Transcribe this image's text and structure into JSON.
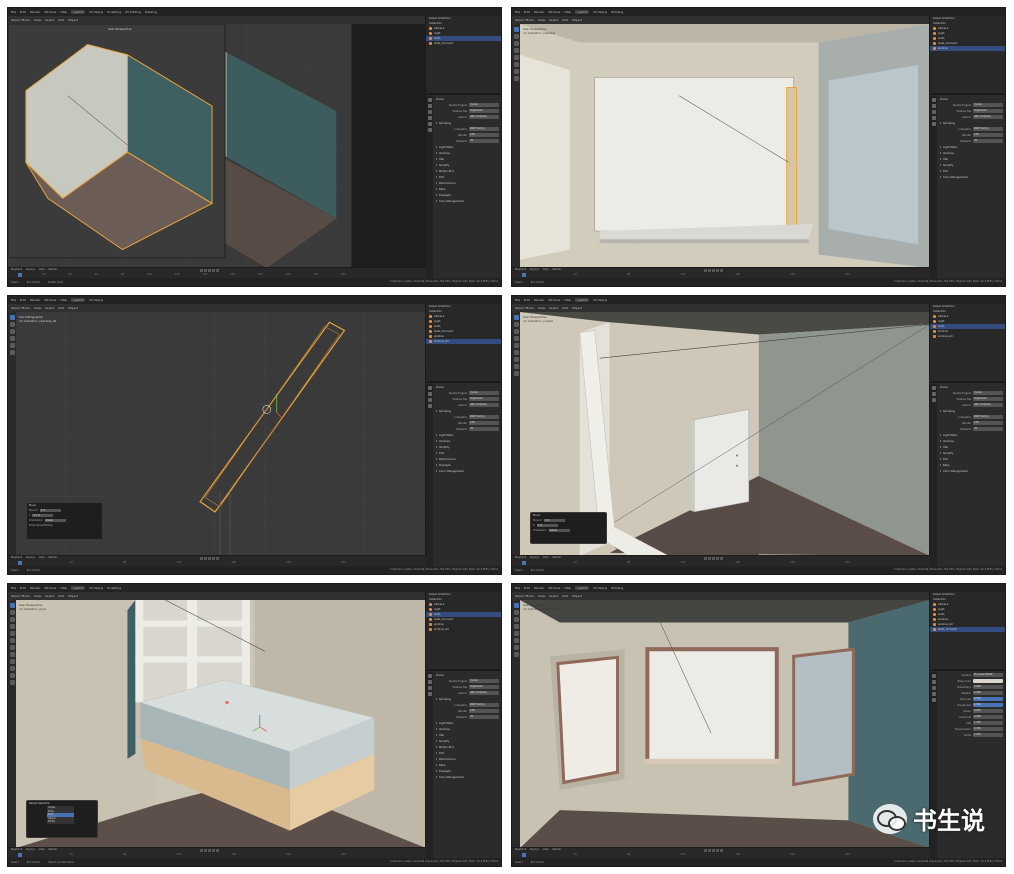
{
  "app": {
    "menus": [
      "File",
      "Edit",
      "Render",
      "Window",
      "Help"
    ],
    "workspaces": [
      "Layout",
      "Modeling",
      "Sculpting",
      "UV Editing",
      "Texture Paint",
      "Shading",
      "Animation",
      "Rendering",
      "Compositing",
      "Scripting"
    ],
    "scene_label": "Scene",
    "view_layer_label": "View Layer"
  },
  "viewport_header": {
    "mode": "Object Mode",
    "menus": [
      "View",
      "Select",
      "Add",
      "Object"
    ],
    "orientation": "Global"
  },
  "outliner": {
    "root": "Scene Collection",
    "collection": "Collection",
    "items": [
      "Camera",
      "Light",
      "walls",
      "walls_mirrored",
      "window",
      "window_sill"
    ]
  },
  "properties": {
    "render_title": "Scene",
    "render_engine_label": "Render Engine",
    "render_engine": "Cycles",
    "feature_set_label": "Feature Set",
    "feature_set": "Supported",
    "device_label": "Device",
    "device": "GPU Compute",
    "sections": [
      "Sampling",
      "Light Paths",
      "Volumes",
      "Hair",
      "Simplify",
      "Motion Blur",
      "Film",
      "Performance",
      "Bake",
      "Freestyle",
      "Color Management"
    ],
    "integrator_label": "Integrator",
    "integrator": "Path Tracing",
    "render_label": "Render",
    "render_value": "128",
    "viewport_label": "Viewport",
    "viewport_value": "32"
  },
  "material_props": {
    "surface_label": "Surface",
    "surface_value": "Principled BSDF",
    "base_color_label": "Base Color",
    "subsurface_label": "Subsurface",
    "subsurface_value": "0.000",
    "metallic_label": "Metallic",
    "metallic_value": "0.000",
    "specular_label": "Specular",
    "specular_value": "0.500",
    "roughness_label": "Roughness",
    "roughness_value": "0.500",
    "sheen_label": "Sheen",
    "sheen_value": "0.000",
    "clearcoat_label": "Clearcoat",
    "clearcoat_value": "0.000",
    "ior_label": "IOR",
    "ior_value": "1.450",
    "transmission_label": "Transmission",
    "transmission_value": "0.000",
    "alpha_label": "Alpha",
    "alpha_value": "1.000"
  },
  "timeline": {
    "menus": [
      "Playback",
      "Keying",
      "View",
      "Marker"
    ],
    "ticks": [
      "0",
      "20",
      "40",
      "60",
      "80",
      "100",
      "120",
      "140",
      "160",
      "180",
      "200",
      "220",
      "240"
    ],
    "start_label": "Start",
    "start": "1",
    "end_label": "End",
    "end": "250"
  },
  "statusbar": {
    "select": "Select",
    "box_select": "Box Select",
    "rotate": "Rotate View",
    "context": "Object Context Menu",
    "stats": "Collection | walls | Verts:96 | Faces:90 | Tris:180 | Objects:1/6 | Mem: 31.2 MiB | 2.83.0"
  },
  "panels": [
    {
      "id": "p1",
      "viewport_label": "User Perspective",
      "collection_label": "(1) Collection | walls"
    },
    {
      "id": "p2",
      "viewport_label": "User Perspective",
      "collection_label": "(1) Collection | window"
    },
    {
      "id": "p3",
      "viewport_label": "Top Orthographic",
      "collection_label": "(1) Collection | window_sill"
    },
    {
      "id": "p4",
      "viewport_label": "User Perspective",
      "collection_label": "(1) Collection | closet"
    },
    {
      "id": "p5",
      "viewport_label": "User Perspective",
      "collection_label": "(1) Collection | bed"
    },
    {
      "id": "p6",
      "viewport_label": "User Perspective",
      "collection_label": "(1) Collection | window.002"
    }
  ],
  "popups": {
    "move_title": "Move",
    "move_x": "Move X",
    "move_x_value": "0 m",
    "move_y": "Y",
    "move_y_value": "0.1 m",
    "move_z": "Z",
    "move_z_value": "0 m",
    "orientation_label": "Orientation",
    "orientation_value": "Global",
    "proportional": "Proportional Editing",
    "bevel_title": "Resize Selection",
    "bevel_options": [
      "Vertex",
      "Edge",
      "Face",
      "Object",
      "Whole"
    ],
    "bevel_selected": "Face",
    "snap_label": "Limit to"
  },
  "watermark": {
    "text": "书生说"
  },
  "colors": {
    "selection": "#334d80",
    "active_tool": "#4772b3",
    "object_outline": "#e8a33a",
    "wall_cream": "#d6d0c2",
    "wall_teal": "#3e5e64",
    "floor_brown": "#5e514a"
  }
}
